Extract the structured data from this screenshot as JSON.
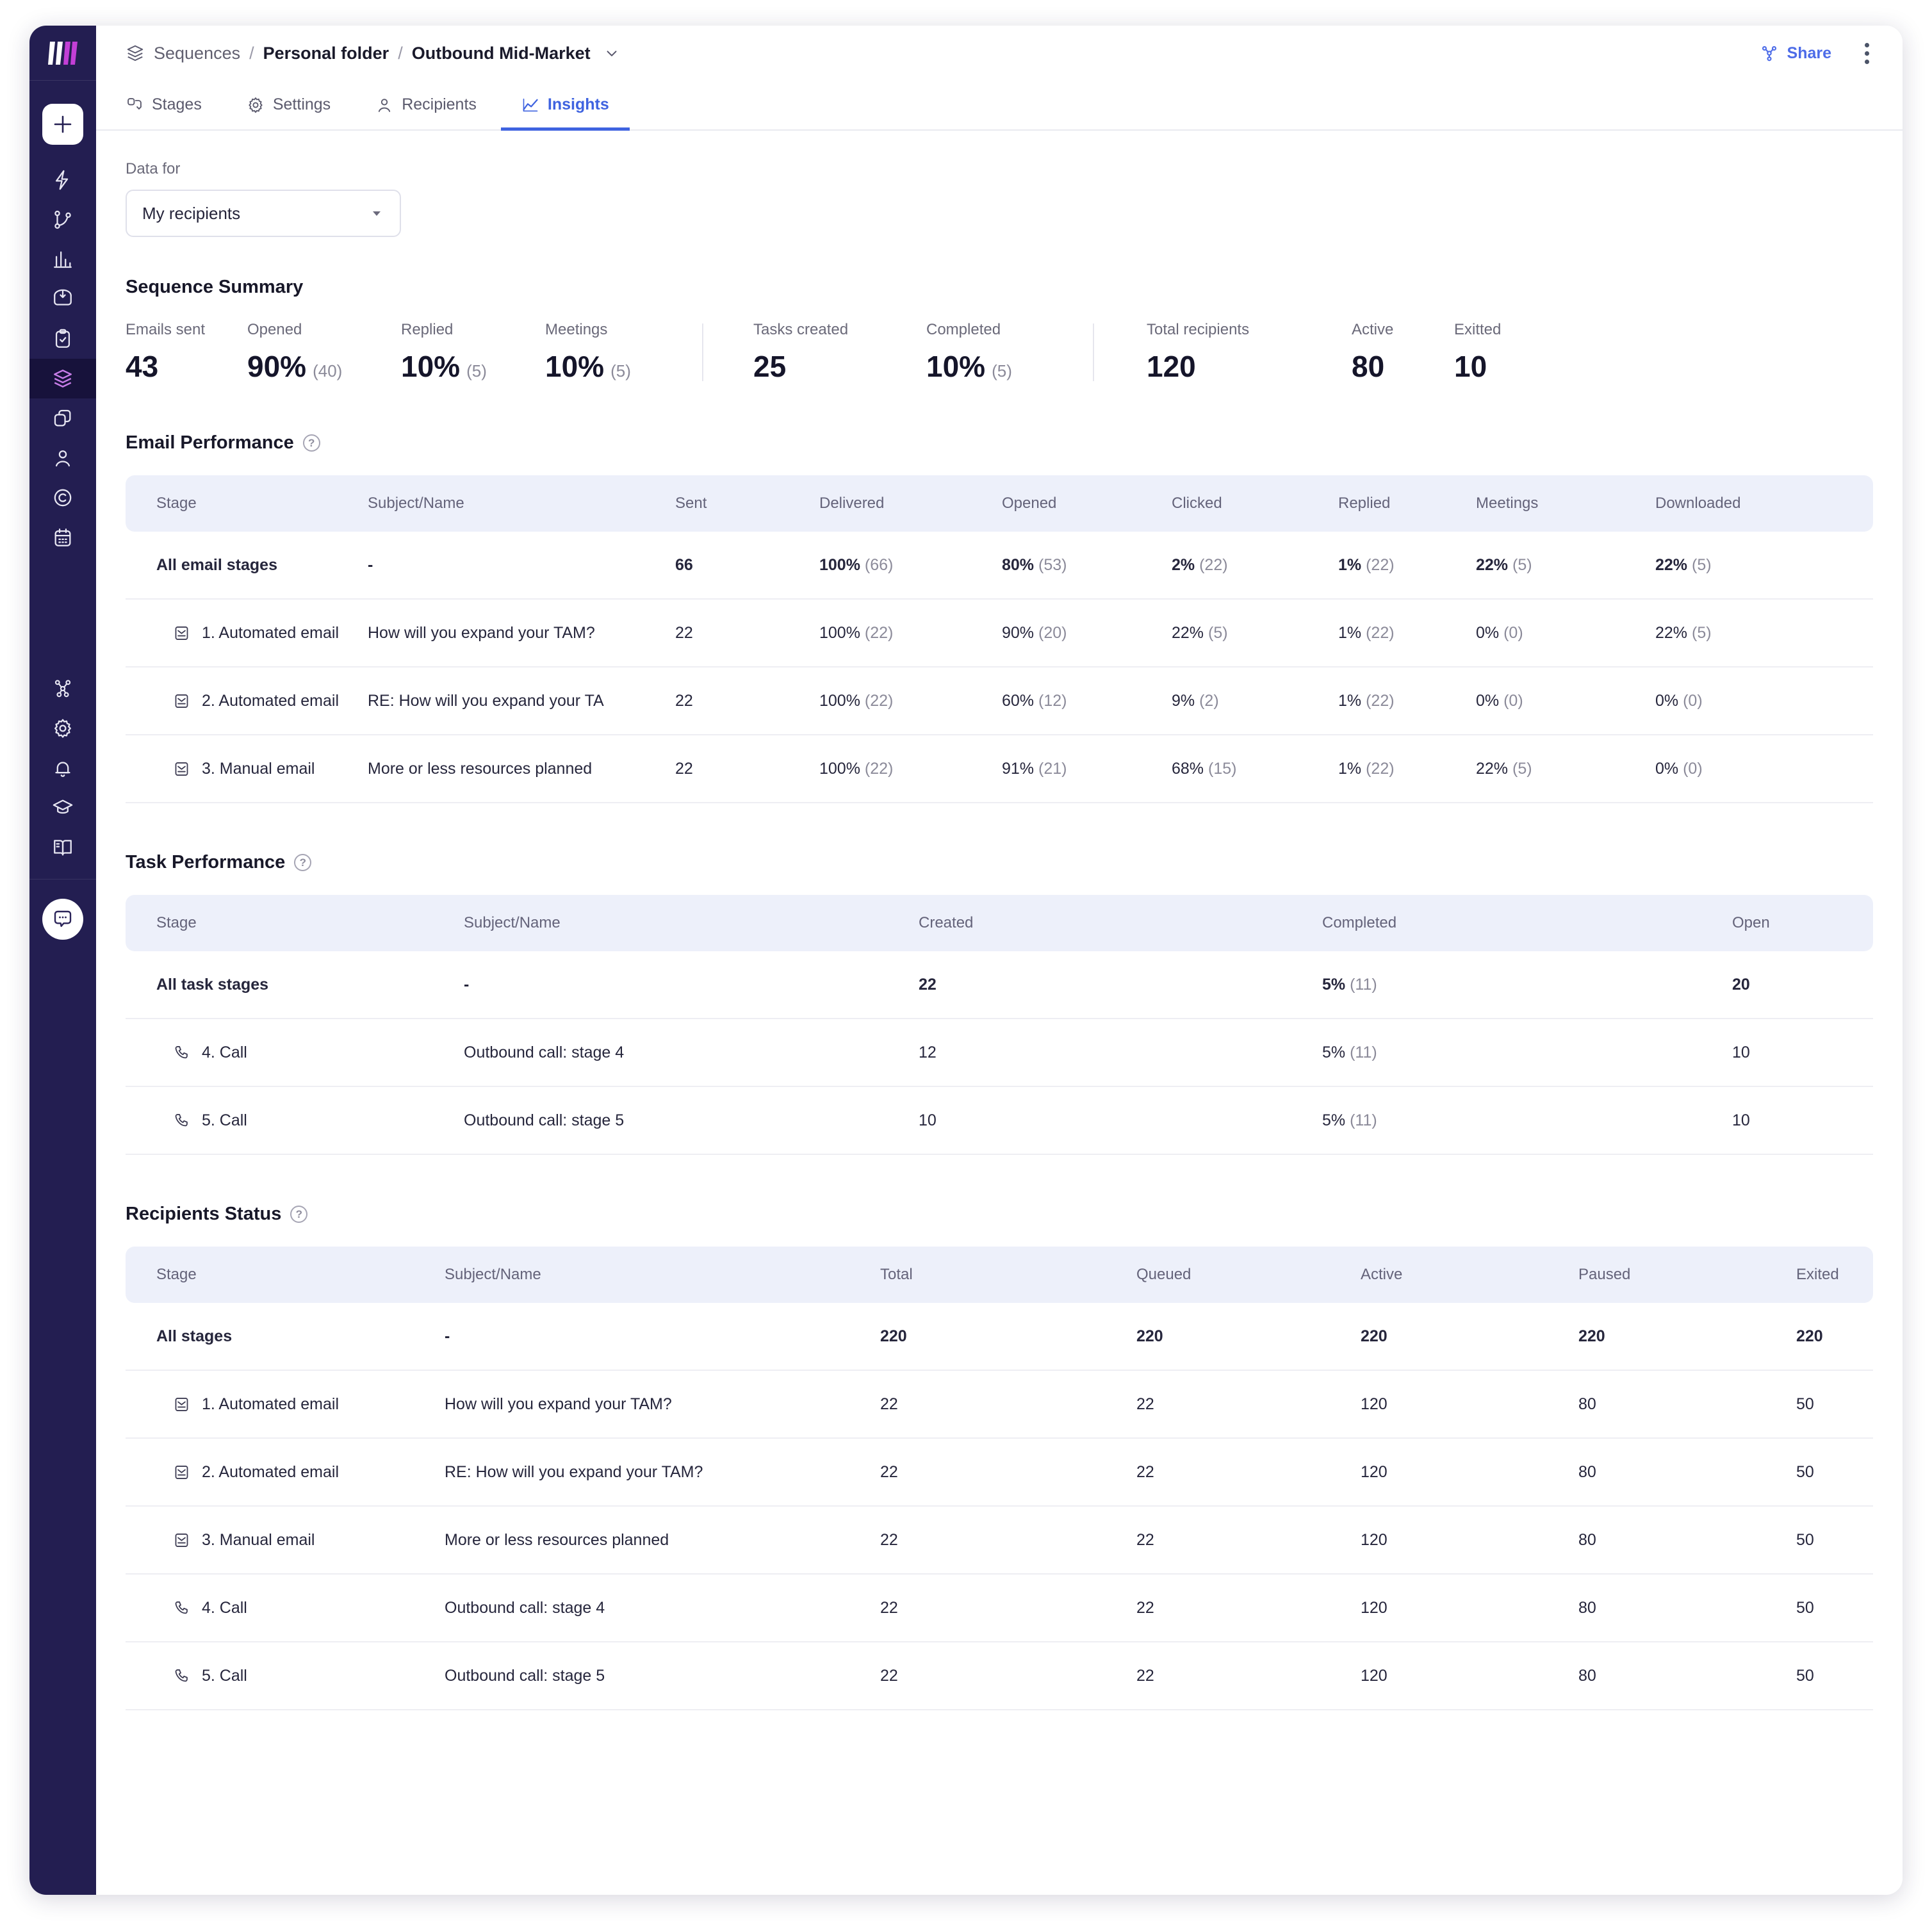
{
  "sidebar": {
    "logo": "workspace-logo",
    "add_button": "add-icon",
    "items": [
      {
        "icon": "lightning-icon",
        "name": "automations"
      },
      {
        "icon": "branch-icon",
        "name": "workflows"
      },
      {
        "icon": "bar-chart-icon",
        "name": "analytics"
      },
      {
        "icon": "inbox-icon",
        "name": "inbox"
      },
      {
        "icon": "clipboard-check-icon",
        "name": "tasks"
      },
      {
        "icon": "layers-icon",
        "name": "sequences",
        "active": true
      },
      {
        "icon": "copy-icon",
        "name": "templates"
      },
      {
        "icon": "person-icon",
        "name": "contacts"
      },
      {
        "icon": "circle-c-icon",
        "name": "companies"
      },
      {
        "icon": "calendar-icon",
        "name": "calendar"
      }
    ],
    "bottom_items": [
      {
        "icon": "team-icon",
        "name": "team"
      },
      {
        "icon": "gear-icon",
        "name": "settings"
      },
      {
        "icon": "bell-icon",
        "name": "notifications"
      },
      {
        "icon": "graduation-cap-icon",
        "name": "academy"
      },
      {
        "icon": "book-icon",
        "name": "knowledge-base"
      }
    ],
    "chat_fab": "chat-bubble-icon"
  },
  "header": {
    "breadcrumb": {
      "root": "Sequences",
      "folder": "Personal folder",
      "current": "Outbound Mid-Market",
      "separator": "/"
    },
    "share_label": "Share",
    "more_label": "more-options"
  },
  "tabs": [
    {
      "label": "Stages",
      "icon": "stages-icon",
      "active": false
    },
    {
      "label": "Settings",
      "icon": "gear-icon",
      "active": false
    },
    {
      "label": "Recipients",
      "icon": "person-icon",
      "active": false
    },
    {
      "label": "Insights",
      "icon": "chart-line-icon",
      "active": true
    }
  ],
  "filter": {
    "label": "Data for",
    "selected": "My recipients"
  },
  "summary": {
    "title": "Sequence Summary",
    "group1": [
      {
        "label": "Emails sent",
        "value": "43",
        "sub": ""
      },
      {
        "label": "Opened",
        "value": "90%",
        "sub": "(40)"
      },
      {
        "label": "Replied",
        "value": "10%",
        "sub": "(5)"
      },
      {
        "label": "Meetings",
        "value": "10%",
        "sub": "(5)"
      }
    ],
    "group2": [
      {
        "label": "Tasks created",
        "value": "25",
        "sub": ""
      },
      {
        "label": "Completed",
        "value": "10%",
        "sub": "(5)"
      }
    ],
    "group3": [
      {
        "label": "Total recipients",
        "value": "120",
        "sub": ""
      },
      {
        "label": "Active",
        "value": "80",
        "sub": ""
      },
      {
        "label": "Exitted",
        "value": "10",
        "sub": ""
      }
    ]
  },
  "email_performance": {
    "title": "Email Performance",
    "help": "?",
    "columns": [
      "Stage",
      "Subject/Name",
      "Sent",
      "Delivered",
      "Opened",
      "Clicked",
      "Replied",
      "Meetings",
      "Downloaded"
    ],
    "total_row": {
      "stage": "All email stages",
      "subject": "-",
      "sent": "66",
      "delivered": "100%",
      "delivered_n": "(66)",
      "opened": "80%",
      "opened_n": "(53)",
      "clicked": "2%",
      "clicked_n": "(22)",
      "replied": "1%",
      "replied_n": "(22)",
      "meetings": "22%",
      "meetings_n": "(5)",
      "downloaded": "22%",
      "downloaded_n": "(5)"
    },
    "rows": [
      {
        "icon": "email-icon",
        "stage": "1. Automated email",
        "subject": "How will you expand your TAM?",
        "sent": "22",
        "delivered": "100%",
        "delivered_n": "(22)",
        "opened": "90%",
        "opened_n": "(20)",
        "clicked": "22%",
        "clicked_n": "(5)",
        "replied": "1%",
        "replied_n": "(22)",
        "meetings": "0%",
        "meetings_n": "(0)",
        "downloaded": "22%",
        "downloaded_n": "(5)"
      },
      {
        "icon": "email-icon",
        "stage": "2. Automated email",
        "subject": "RE: How will you expand your TA",
        "sent": "22",
        "delivered": "100%",
        "delivered_n": "(22)",
        "opened": "60%",
        "opened_n": "(12)",
        "clicked": "9%",
        "clicked_n": "(2)",
        "replied": "1%",
        "replied_n": "(22)",
        "meetings": "0%",
        "meetings_n": "(0)",
        "downloaded": "0%",
        "downloaded_n": "(0)"
      },
      {
        "icon": "email-icon",
        "stage": "3. Manual email",
        "subject": "More or less resources planned",
        "sent": "22",
        "delivered": "100%",
        "delivered_n": "(22)",
        "opened": "91%",
        "opened_n": "(21)",
        "clicked": "68%",
        "clicked_n": "(15)",
        "replied": "1%",
        "replied_n": "(22)",
        "meetings": "22%",
        "meetings_n": "(5)",
        "downloaded": "0%",
        "downloaded_n": "(0)"
      }
    ]
  },
  "task_performance": {
    "title": "Task Performance",
    "help": "?",
    "columns": [
      "Stage",
      "Subject/Name",
      "Created",
      "Completed",
      "Open"
    ],
    "total_row": {
      "stage": "All task stages",
      "subject": "-",
      "created": "22",
      "completed": "5%",
      "completed_n": "(11)",
      "open": "20"
    },
    "rows": [
      {
        "icon": "phone-icon",
        "stage": "4. Call",
        "subject": "Outbound call: stage 4",
        "created": "12",
        "completed": "5%",
        "completed_n": "(11)",
        "open": "10"
      },
      {
        "icon": "phone-icon",
        "stage": "5. Call",
        "subject": "Outbound call: stage 5",
        "created": "10",
        "completed": "5%",
        "completed_n": "(11)",
        "open": "10"
      }
    ]
  },
  "recipients_status": {
    "title": "Recipients Status",
    "help": "?",
    "columns": [
      "Stage",
      "Subject/Name",
      "Total",
      "Queued",
      "Active",
      "Paused",
      "Exited"
    ],
    "total_row": {
      "stage": "All stages",
      "subject": "-",
      "total": "220",
      "queued": "220",
      "active": "220",
      "paused": "220",
      "exited": "220"
    },
    "rows": [
      {
        "icon": "email-icon",
        "stage": "1. Automated email",
        "subject": "How will you expand your TAM?",
        "total": "22",
        "queued": "22",
        "active": "120",
        "paused": "80",
        "exited": "50"
      },
      {
        "icon": "email-icon",
        "stage": "2. Automated email",
        "subject": "RE: How will you expand your TAM?",
        "total": "22",
        "queued": "22",
        "active": "120",
        "paused": "80",
        "exited": "50"
      },
      {
        "icon": "email-icon",
        "stage": "3. Manual email",
        "subject": "More or less resources planned",
        "total": "22",
        "queued": "22",
        "active": "120",
        "paused": "80",
        "exited": "50"
      },
      {
        "icon": "phone-icon",
        "stage": "4. Call",
        "subject": "Outbound call: stage 4",
        "total": "22",
        "queued": "22",
        "active": "120",
        "paused": "80",
        "exited": "50"
      },
      {
        "icon": "phone-icon",
        "stage": "5. Call",
        "subject": "Outbound call: stage 5",
        "total": "22",
        "queued": "22",
        "active": "120",
        "paused": "80",
        "exited": "50"
      }
    ]
  },
  "colors": {
    "sidebar": "#231E51",
    "sidebar_active": "#17123B",
    "accent": "#3F63E0",
    "share": "#4D6CE8",
    "table_header": "#EDF0FA",
    "logo_pink": "#C23FD6",
    "text_dark": "#15152A",
    "text_muted": "#6A6979"
  }
}
